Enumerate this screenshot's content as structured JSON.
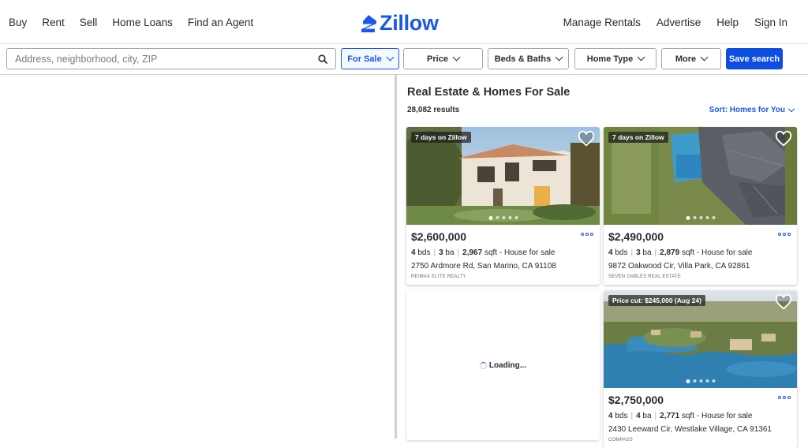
{
  "nav": {
    "left": [
      "Buy",
      "Rent",
      "Sell",
      "Home Loans",
      "Find an Agent"
    ],
    "right": [
      "Manage Rentals",
      "Advertise",
      "Help",
      "Sign In"
    ],
    "logo": "Zillow"
  },
  "filters": {
    "search_placeholder": "Address, neighborhood, city, ZIP",
    "for_sale": "For Sale",
    "price": "Price",
    "beds_baths": "Beds & Baths",
    "home_type": "Home Type",
    "more": "More",
    "save_search": "Save search"
  },
  "results": {
    "title": "Real Estate & Homes For Sale",
    "count": "28,082 results",
    "sort": "Sort: Homes for You",
    "loading": "Loading...",
    "listings": [
      {
        "badge": "7 days on Zillow",
        "price": "$2,600,000",
        "beds": "4",
        "beds_unit": "bds",
        "baths": "3",
        "baths_unit": "ba",
        "sqft": "2,967",
        "sqft_unit": "sqft - House for sale",
        "address": "2750 Ardmore Rd, San Marino, CA 91108",
        "broker": "RE/MAX ELITE REALTY"
      },
      {
        "badge": "7 days on Zillow",
        "price": "$2,490,000",
        "beds": "4",
        "beds_unit": "bds",
        "baths": "3",
        "baths_unit": "ba",
        "sqft": "2,879",
        "sqft_unit": "sqft - House for sale",
        "address": "9872 Oakwood Cir, Villa Park, CA 92861",
        "broker": "SEVEN GABLES REAL ESTATE"
      },
      {
        "badge": "Price cut: $245,000 (Aug 24)",
        "price": "$2,750,000",
        "beds": "4",
        "beds_unit": "bds",
        "baths": "4",
        "baths_unit": "ba",
        "sqft": "2,771",
        "sqft_unit": "sqft - House for sale",
        "address": "2430 Leeward Cir, Westlake Village, CA 91361",
        "broker": "COMPASS"
      }
    ]
  },
  "colors": {
    "brand": "#1b57e8",
    "save_button": "#0d4de1",
    "text": "#2a2a33"
  }
}
